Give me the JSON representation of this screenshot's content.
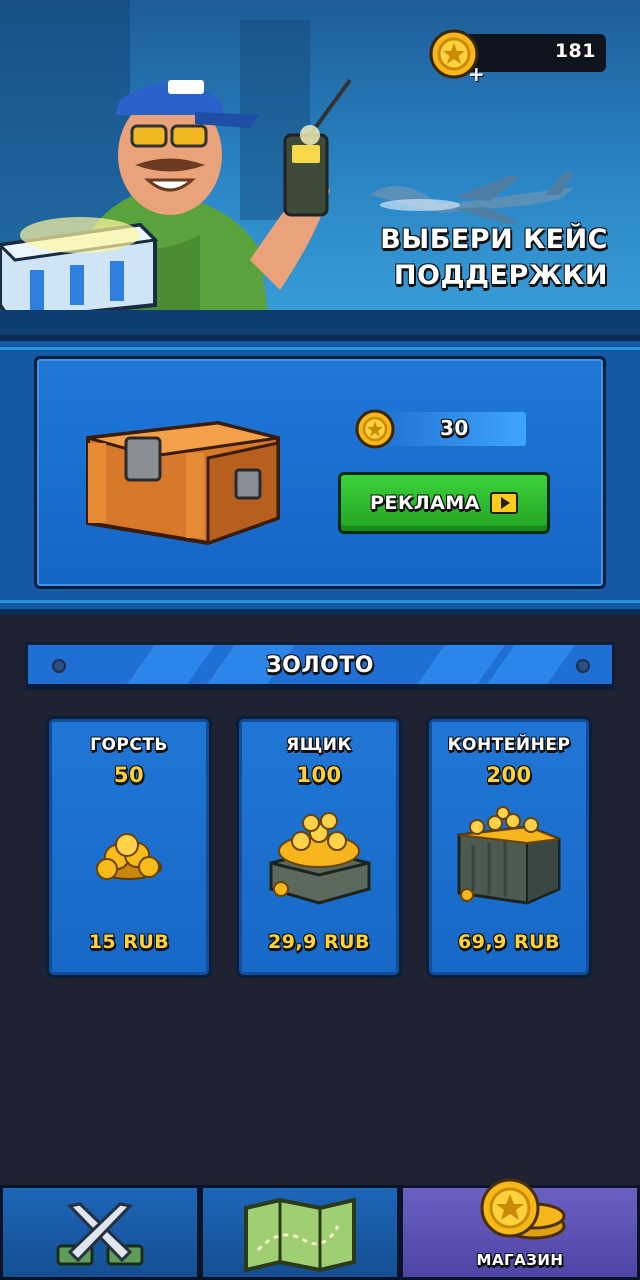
{
  "header": {
    "coins": "181",
    "plus": "+",
    "title_line1": "ВЫБЕРИ КЕЙС",
    "title_line2": "ПОДДЕРЖКИ"
  },
  "support_case": {
    "price": "30",
    "ad_button_label": "РЕКЛАМА"
  },
  "gold_section": {
    "title": "ЗОЛОТО",
    "offers": [
      {
        "name": "ГОРСТЬ",
        "amount": "50",
        "price": "15 RUB",
        "art": "coin-handful-icon"
      },
      {
        "name": "ЯЩИК",
        "amount": "100",
        "price": "29,9 RUB",
        "art": "coin-box-icon"
      },
      {
        "name": "КОНТЕЙНЕР",
        "amount": "200",
        "price": "69,9 RUB",
        "art": "coin-container-icon"
      }
    ]
  },
  "nav": {
    "tabs": [
      {
        "icon": "crossed-swords-icon",
        "label": ""
      },
      {
        "icon": "map-icon",
        "label": ""
      },
      {
        "icon": "coin-stack-icon",
        "label": "МАГАЗИН",
        "active": true
      }
    ]
  },
  "colors": {
    "accent_blue": "#1f78d8",
    "gold": "#ffd23a",
    "green_button": "#2fbd30",
    "nav_active": "#5b51b3"
  }
}
